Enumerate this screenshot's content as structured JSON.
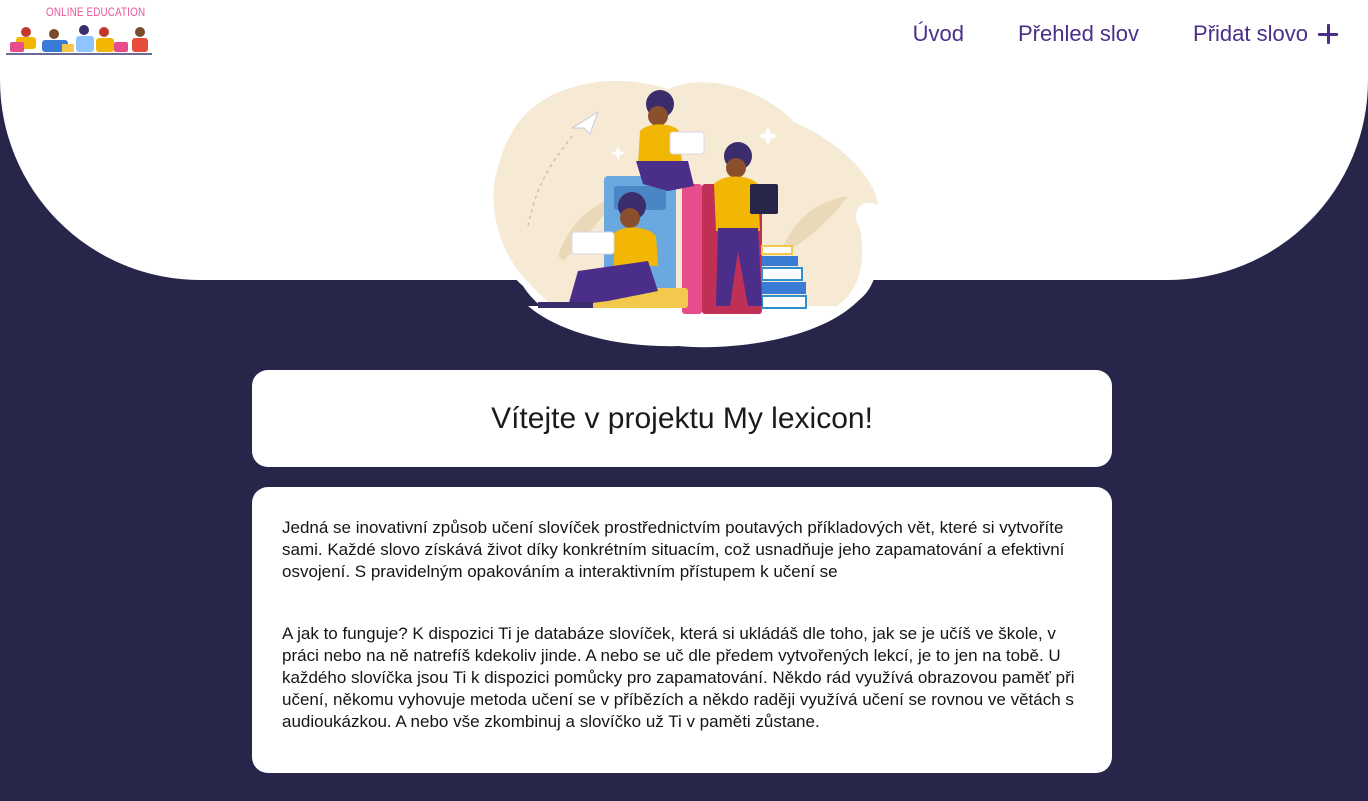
{
  "logo": {
    "text": "ONLINE EDUCATION"
  },
  "nav": {
    "home": "Úvod",
    "overview": "Přehled slov",
    "add_word": "Přidat slovo"
  },
  "welcome": {
    "title": "Vítejte v projektu My lexicon!"
  },
  "intro": {
    "paragraph1": "Jedná se inovativní způsob učení slovíček prostřednictvím poutavých příkladových vět, které si vytvoříte sami. Každé slovo získává život díky konkrétním situacím, což usnadňuje jeho zapamatování a efektivní osvojení. S pravidelným opakováním a interaktivním přístupem k učení se",
    "paragraph2": "A jak to funguje? K dispozici Ti je databáze slovíček, která si ukládáš dle toho, jak se je učíš ve škole, v práci nebo na ně natrefíš kdekoliv jinde. A nebo se uč dle předem vytvořených lekcí, je to jen na tobě. U každého slovíčka jsou Ti k dispozici pomůcky pro zapamatování. Někdo rád využívá obrazovou paměť při učení, někomu vyhovuje metoda učení se v příbězích a někdo raději využívá učení se rovnou ve větách s audioukázkou. A nebo vše zkombinuj a slovíčko už Ti v paměti zůstane."
  },
  "colors": {
    "background": "#27254a",
    "nav_text": "#4a2e8a",
    "logo_text": "#e8559a"
  },
  "icons": {
    "add": "plus-icon"
  }
}
